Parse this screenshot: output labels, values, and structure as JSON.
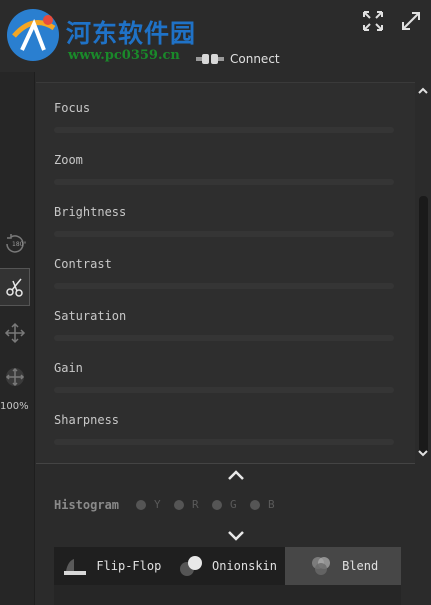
{
  "watermark": {
    "title": "河东软件园",
    "url": "www.pc0359.cn"
  },
  "header": {
    "connect_label": "Connect"
  },
  "icons": {
    "expand": "expand-arrows-icon",
    "fullscreen": "diagonal-arrows-icon",
    "connect": "plug-icon",
    "rotate": "rotate-180-icon",
    "cut": "scissors-icon",
    "move": "move-arrows-icon",
    "zoom": "zoom-arrows-icon"
  },
  "toolbar": {
    "rotate_label": "180°",
    "zoom_level": "100%"
  },
  "controls": [
    {
      "label": "Focus"
    },
    {
      "label": "Zoom"
    },
    {
      "label": "Brightness"
    },
    {
      "label": "Contrast"
    },
    {
      "label": "Saturation"
    },
    {
      "label": "Gain"
    },
    {
      "label": "Sharpness"
    }
  ],
  "histogram": {
    "label": "Histogram",
    "channels": [
      "Y",
      "R",
      "G",
      "B"
    ]
  },
  "tabs": [
    {
      "label": "Flip-Flop",
      "active": false
    },
    {
      "label": "Onionskin",
      "active": false
    },
    {
      "label": "Blend",
      "active": true
    }
  ],
  "colors": {
    "background": "#2b2b2b",
    "panel": "#2e2e2e",
    "active_tab": "#474747",
    "watermark_blue": "#1f72c7",
    "watermark_green": "#1a8a2a"
  }
}
